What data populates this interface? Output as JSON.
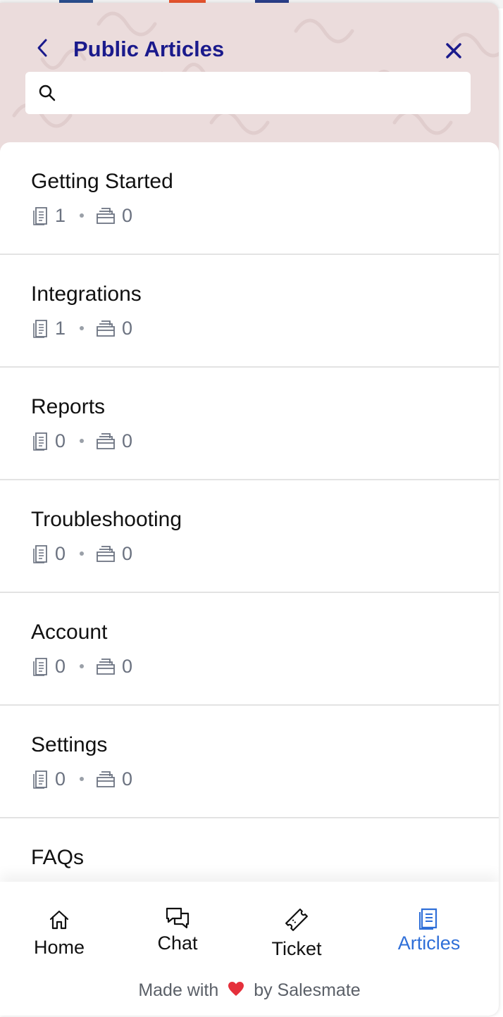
{
  "header": {
    "title": "Public Articles"
  },
  "search": {
    "placeholder": ""
  },
  "categories": [
    {
      "title": "Getting Started",
      "articles": "1",
      "folders": "0"
    },
    {
      "title": "Integrations",
      "articles": "1",
      "folders": "0"
    },
    {
      "title": "Reports",
      "articles": "0",
      "folders": "0"
    },
    {
      "title": "Troubleshooting",
      "articles": "0",
      "folders": "0"
    },
    {
      "title": "Account",
      "articles": "0",
      "folders": "0"
    },
    {
      "title": "Settings",
      "articles": "0",
      "folders": "0"
    },
    {
      "title": "FAQs",
      "articles": "",
      "folders": ""
    }
  ],
  "nav": {
    "home": "Home",
    "chat": "Chat",
    "ticket": "Ticket",
    "articles": "Articles",
    "active": "articles"
  },
  "footer": {
    "made_with": "Made with",
    "by": "by",
    "brand": "Salesmate"
  },
  "colors": {
    "header_bg": "#ebdcdc",
    "title": "#1a1a8c",
    "active_tab": "#2f6fd8",
    "heart": "#e5303b"
  },
  "icons": {
    "back": "chevron-left-icon",
    "close": "close-icon",
    "search": "search-icon",
    "articles_count": "document-icon",
    "folders_count": "folder-stack-icon",
    "home": "home-icon",
    "chat": "chat-bubbles-icon",
    "ticket": "ticket-icon",
    "articles_tab": "article-icon",
    "heart": "heart-icon"
  }
}
